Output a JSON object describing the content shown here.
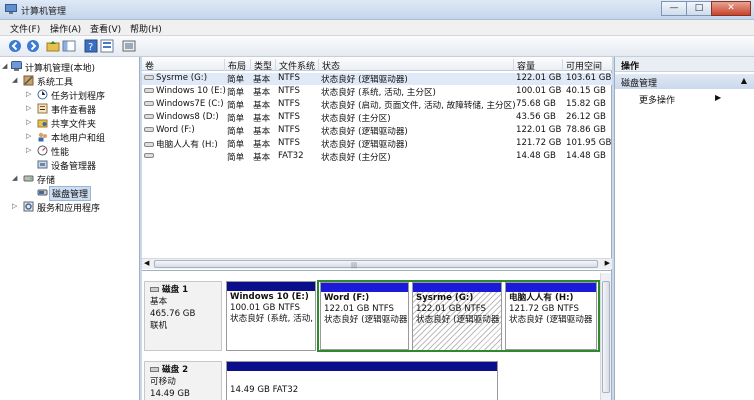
{
  "window": {
    "title": "计算机管理",
    "min": "—",
    "max": "□",
    "close": "✕"
  },
  "menu": [
    "文件(F)",
    "操作(A)",
    "查看(V)",
    "帮助(H)"
  ],
  "toolbar": [
    "back-icon",
    "forward-icon",
    "up-folder-icon",
    "console-tree-icon",
    "help-icon",
    "properties-icon",
    "export-icon"
  ],
  "tree": {
    "root": "计算机管理(本地)",
    "system_tools": "系统工具",
    "task_scheduler": "任务计划程序",
    "event_viewer": "事件查看器",
    "shared_folders": "共享文件夹",
    "local_users": "本地用户和组",
    "performance": "性能",
    "device_manager": "设备管理器",
    "storage": "存储",
    "disk_management": "磁盘管理",
    "services": "服务和应用程序"
  },
  "volumes": {
    "headers": [
      "卷",
      "布局",
      "类型",
      "文件系统",
      "状态",
      "容量",
      "可用空间"
    ],
    "rows": [
      [
        "Sysrme (G:)",
        "简单",
        "基本",
        "NTFS",
        "状态良好 (逻辑驱动器)",
        "122.01 GB",
        "103.61 GB"
      ],
      [
        "Windows 10 (E:)",
        "简单",
        "基本",
        "NTFS",
        "状态良好 (系统, 活动, 主分区)",
        "100.01 GB",
        "40.15 GB"
      ],
      [
        "Windows7E (C:)",
        "简单",
        "基本",
        "NTFS",
        "状态良好 (启动, 页面文件, 活动, 故障转储, 主分区)",
        "75.68 GB",
        "15.82 GB"
      ],
      [
        "Windows8 (D:)",
        "简单",
        "基本",
        "NTFS",
        "状态良好 (主分区)",
        "43.56 GB",
        "26.12 GB"
      ],
      [
        "Word (F:)",
        "简单",
        "基本",
        "NTFS",
        "状态良好 (逻辑驱动器)",
        "122.01 GB",
        "78.86 GB"
      ],
      [
        "电脑人人有 (H:)",
        "简单",
        "基本",
        "NTFS",
        "状态良好 (逻辑驱动器)",
        "121.72 GB",
        "101.95 GB"
      ],
      [
        "",
        "简单",
        "基本",
        "FAT32",
        "状态良好 (主分区)",
        "14.48 GB",
        "14.48 GB"
      ]
    ],
    "scroll_grip": "|||"
  },
  "disks": [
    {
      "name": "磁盘 1",
      "type": "基本",
      "size": "465.76 GB",
      "status": "联机",
      "parts": [
        {
          "name": "Windows 10 (E:)",
          "size": "100.01 GB NTFS",
          "status": "状态良好 (系统, 活动,",
          "bar_color": "#0c0f8a"
        },
        {
          "name": "Word (F:)",
          "size": "122.01 GB NTFS",
          "status": "状态良好 (逻辑驱动器",
          "bar_color": "#1a1ad8"
        },
        {
          "name": "Sysrme (G:)",
          "size": "122.01 GB NTFS",
          "status": "状态良好 (逻辑驱动器",
          "bar_color": "#1a1ad8"
        },
        {
          "name": "电脑人人有 (H:)",
          "size": "121.72 GB NTFS",
          "status": "状态良好 (逻辑驱动器",
          "bar_color": "#1a1ad8"
        }
      ]
    },
    {
      "name": "磁盘 2",
      "type": "可移动",
      "size": "14.49 GB",
      "status": "",
      "parts": [
        {
          "name": "",
          "size": "14.49 GB FAT32",
          "status": "",
          "bar_color": "#0c0f8a"
        }
      ]
    }
  ],
  "actions": {
    "header": "操作",
    "section": "磁盘管理",
    "more": "更多操作",
    "arrow_up": "▲",
    "arrow_right": "▶"
  },
  "colors": {
    "primary_bar": "#0c0f8a",
    "logical_bar": "#1a1ad8",
    "logical_border": "#2f8a2f",
    "selection": "#cddcf1"
  }
}
